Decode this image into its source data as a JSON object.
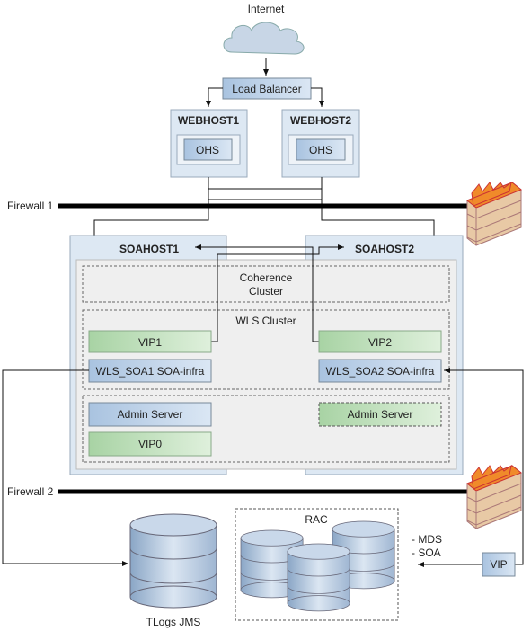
{
  "internet": "Internet",
  "load_balancer": "Load Balancer",
  "webhosts": [
    {
      "title": "WEBHOST1",
      "ohs": "OHS"
    },
    {
      "title": "WEBHOST2",
      "ohs": "OHS"
    }
  ],
  "firewall1": "Firewall 1",
  "firewall2": "Firewall 2",
  "soahosts": [
    "SOAHOST1",
    "SOAHOST2"
  ],
  "coherence": [
    "Coherence",
    "Cluster"
  ],
  "wls_cluster": "WLS Cluster",
  "vip1": "VIP1",
  "vip2": "VIP2",
  "vip0": "VIP0",
  "wls_soa1": "WLS_SOA1 SOA-infra",
  "wls_soa2": "WLS_SOA2 SOA-infra",
  "admin1": "Admin Server",
  "admin2": "Admin Server",
  "rac": "RAC",
  "db_vip": "VIP",
  "mds": "- MDS",
  "soa": "- SOA",
  "tlogs": "TLogs JMS",
  "colors": {
    "blue": "#b9cfe6",
    "green": "#b7dcb4",
    "host": "#dde8f3",
    "cluster": "#efefef"
  }
}
